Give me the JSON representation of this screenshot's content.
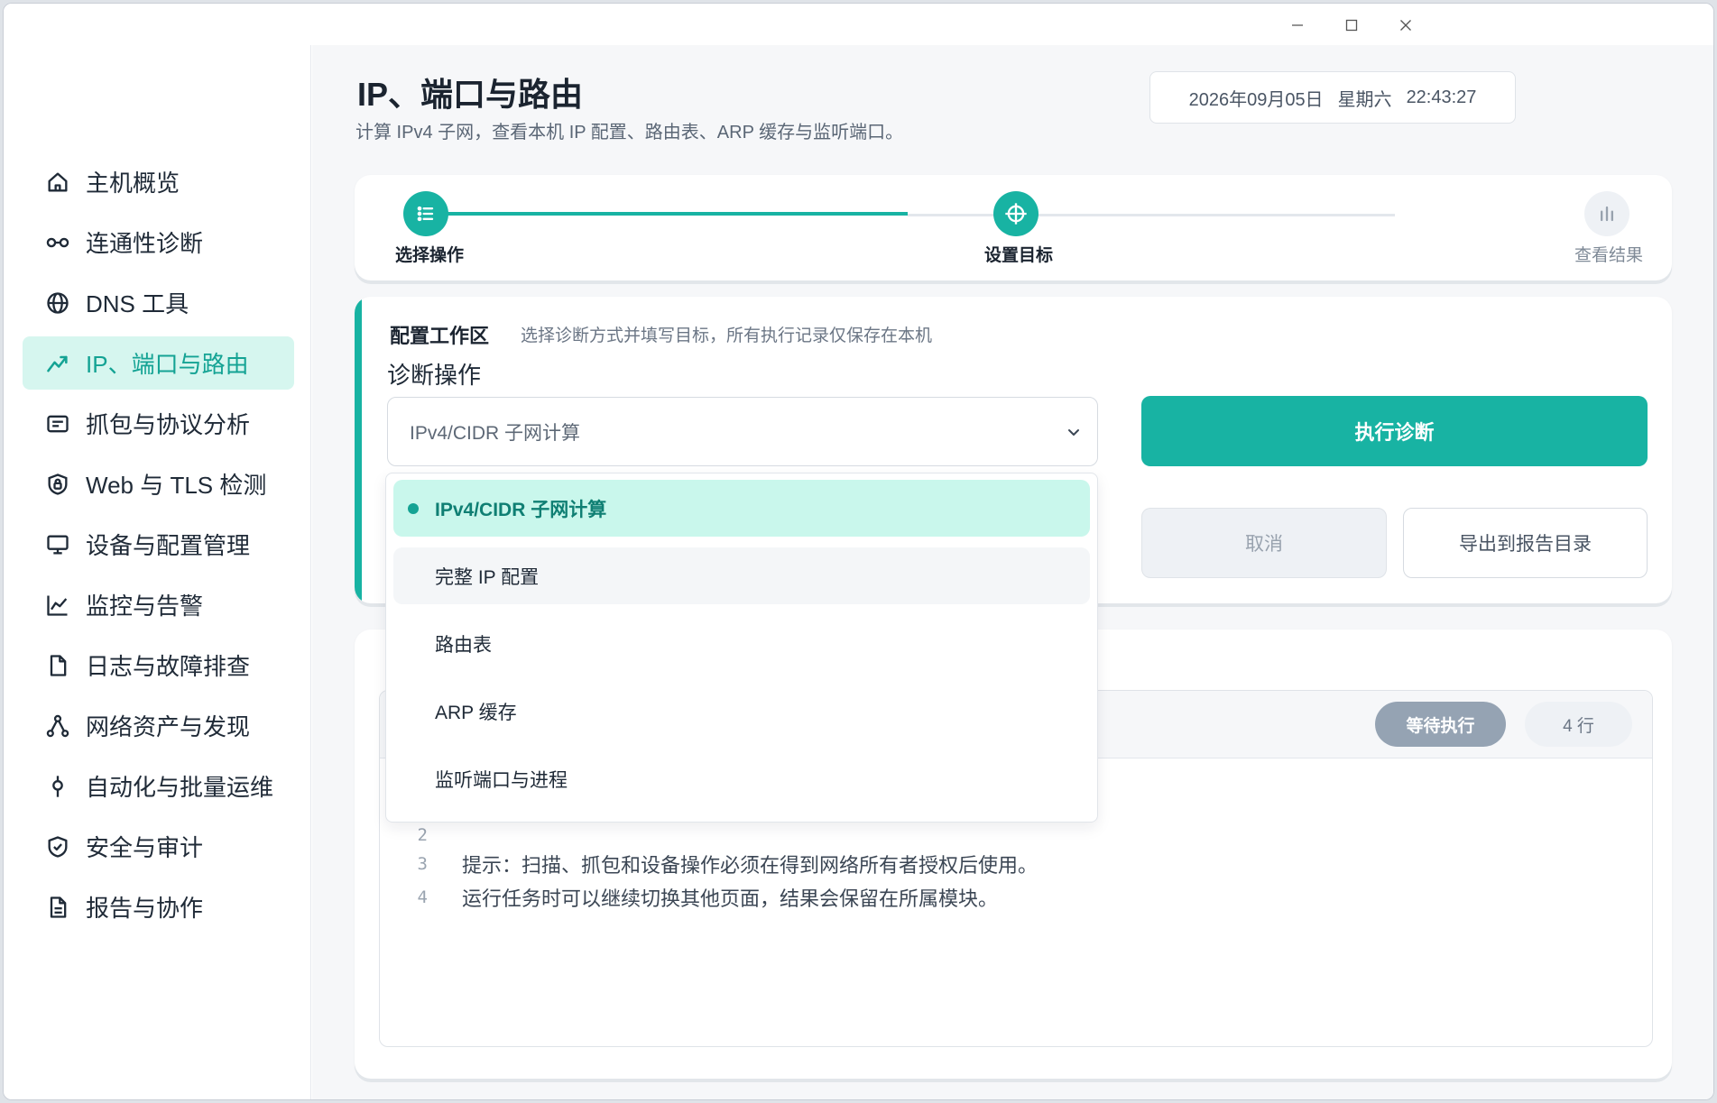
{
  "window": {
    "controls": [
      "minimize-icon",
      "maximize-icon",
      "close-icon"
    ]
  },
  "sidebar": {
    "items": [
      {
        "label": "主机概览",
        "icon": "home-icon"
      },
      {
        "label": "连通性诊断",
        "icon": "link-icon"
      },
      {
        "label": "DNS 工具",
        "icon": "globe-icon"
      },
      {
        "label": "IP、端口与路由",
        "icon": "route-icon",
        "active": true
      },
      {
        "label": "抓包与协议分析",
        "icon": "packet-icon"
      },
      {
        "label": "Web 与 TLS 检测",
        "icon": "shield-lock-icon"
      },
      {
        "label": "设备与配置管理",
        "icon": "monitor-icon"
      },
      {
        "label": "监控与告警",
        "icon": "chart-icon"
      },
      {
        "label": "日志与故障排查",
        "icon": "file-icon"
      },
      {
        "label": "网络资产与发现",
        "icon": "network-icon"
      },
      {
        "label": "自动化与批量运维",
        "icon": "automation-icon"
      },
      {
        "label": "安全与审计",
        "icon": "shield-check-icon"
      },
      {
        "label": "报告与协作",
        "icon": "report-icon"
      }
    ]
  },
  "header": {
    "title": "IP、端口与路由",
    "subtitle": "计算 IPv4 子网，查看本机 IP 配置、路由表、ARP 缓存与监听端口。",
    "date": "2026年09月05日",
    "weekday": "星期六",
    "time": "22:43:27"
  },
  "stepper": {
    "steps": [
      {
        "label": "选择操作",
        "icon": "list-icon",
        "state": "done"
      },
      {
        "label": "设置目标",
        "icon": "target-icon",
        "state": "current"
      },
      {
        "label": "查看结果",
        "icon": "bars-icon",
        "state": "pending"
      }
    ],
    "accent": "#18b3a3"
  },
  "config": {
    "title": "配置工作区",
    "description": "选择诊断方式并填写目标，所有执行记录仅保存在本机",
    "field_label": "诊断操作",
    "selected_value": "IPv4/CIDR 子网计算",
    "run_label": "执行诊断",
    "cancel_label": "取消",
    "export_label": "导出到报告目录"
  },
  "dropdown": {
    "options": [
      {
        "label": "IPv4/CIDR 子网计算",
        "selected": true
      },
      {
        "label": "完整 IP 配置",
        "hover": true
      },
      {
        "label": "路由表"
      },
      {
        "label": "ARP 缓存"
      },
      {
        "label": "监听端口与进程"
      }
    ]
  },
  "output": {
    "status_badge": "等待执行",
    "rows_badge": "4 行",
    "lines": [
      {
        "num": "2",
        "text": ""
      },
      {
        "num": "3",
        "text": "提示：扫描、抓包和设备操作必须在得到网络所有者授权后使用。"
      },
      {
        "num": "4",
        "text": "运行任务时可以继续切换其他页面，结果会保留在所属模块。"
      }
    ]
  },
  "colors": {
    "accent": "#18b3a3",
    "accent_light": "#d6f6ef",
    "muted": "#95a3b3"
  }
}
